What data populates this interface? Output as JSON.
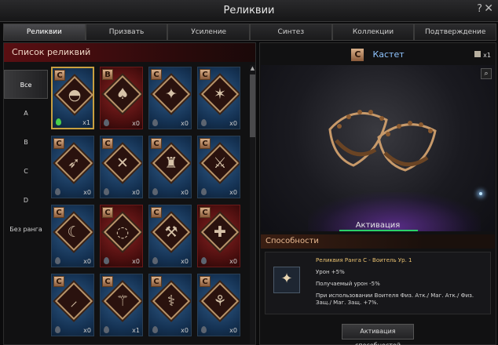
{
  "window": {
    "title": "Реликвии",
    "help": "?",
    "close": "✕"
  },
  "tabs": [
    {
      "label": "Реликвии",
      "active": true
    },
    {
      "label": "Призвать",
      "active": false
    },
    {
      "label": "Усиление",
      "active": false
    },
    {
      "label": "Синтез",
      "active": false
    },
    {
      "label": "Коллекции",
      "active": false
    },
    {
      "label": "Подтверждение",
      "active": false
    }
  ],
  "list": {
    "header": "Список реликвий",
    "filters": [
      "Все",
      "A",
      "B",
      "C",
      "D",
      "Без ранга"
    ],
    "cards": [
      {
        "grade": "C",
        "art": "◓",
        "count": "x1",
        "color": "blue",
        "selected": true,
        "drop_green": true
      },
      {
        "grade": "B",
        "art": "♠",
        "count": "x0",
        "color": "red",
        "selected": false,
        "drop_green": false
      },
      {
        "grade": "C",
        "art": "✦",
        "count": "x0",
        "color": "blue",
        "selected": false,
        "drop_green": false
      },
      {
        "grade": "C",
        "art": "✶",
        "count": "x0",
        "color": "blue",
        "selected": false,
        "drop_green": false
      },
      {
        "grade": "C",
        "art": "➶",
        "count": "x0",
        "color": "blue",
        "selected": false,
        "drop_green": false
      },
      {
        "grade": "C",
        "art": "✕",
        "count": "x0",
        "color": "blue",
        "selected": false,
        "drop_green": false
      },
      {
        "grade": "C",
        "art": "♜",
        "count": "x0",
        "color": "blue",
        "selected": false,
        "drop_green": false
      },
      {
        "grade": "C",
        "art": "⚔",
        "count": "x0",
        "color": "blue",
        "selected": false,
        "drop_green": false
      },
      {
        "grade": "C",
        "art": "☾",
        "count": "x0",
        "color": "blue",
        "selected": false,
        "drop_green": false
      },
      {
        "grade": "C",
        "art": "◌",
        "count": "x0",
        "color": "red",
        "selected": false,
        "drop_green": false
      },
      {
        "grade": "C",
        "art": "⚒",
        "count": "x0",
        "color": "blue",
        "selected": false,
        "drop_green": false
      },
      {
        "grade": "C",
        "art": "✚",
        "count": "x0",
        "color": "red",
        "selected": false,
        "drop_green": false
      },
      {
        "grade": "C",
        "art": "⸝",
        "count": "x0",
        "color": "blue",
        "selected": false,
        "drop_green": false
      },
      {
        "grade": "C",
        "art": "⚚",
        "count": "x1",
        "color": "blue",
        "selected": false,
        "drop_green": false
      },
      {
        "grade": "C",
        "art": "⚕",
        "count": "x0",
        "color": "blue",
        "selected": false,
        "drop_green": false
      },
      {
        "grade": "C",
        "art": "⚘",
        "count": "x0",
        "color": "blue",
        "selected": false,
        "drop_green": false
      }
    ]
  },
  "detail": {
    "grade": "C",
    "name": "Кастет",
    "owned": "x1",
    "activation_label": "Активация",
    "abilities_header": "Способности",
    "ability_lines": [
      "Реликвия Ранга С - Воитель Ур. 1",
      "Урон +5%",
      "Получаемый урон -5%",
      "При использовании Воителя Физ. Атк./ Маг. Атк./ Физ. Защ./ Маг. Защ. +7%."
    ],
    "activate_button": "Активация способностей"
  },
  "colors": {
    "accent_gold": "#c8a040",
    "name_blue": "#8fc4ff",
    "activation_green": "#2cd06a"
  }
}
